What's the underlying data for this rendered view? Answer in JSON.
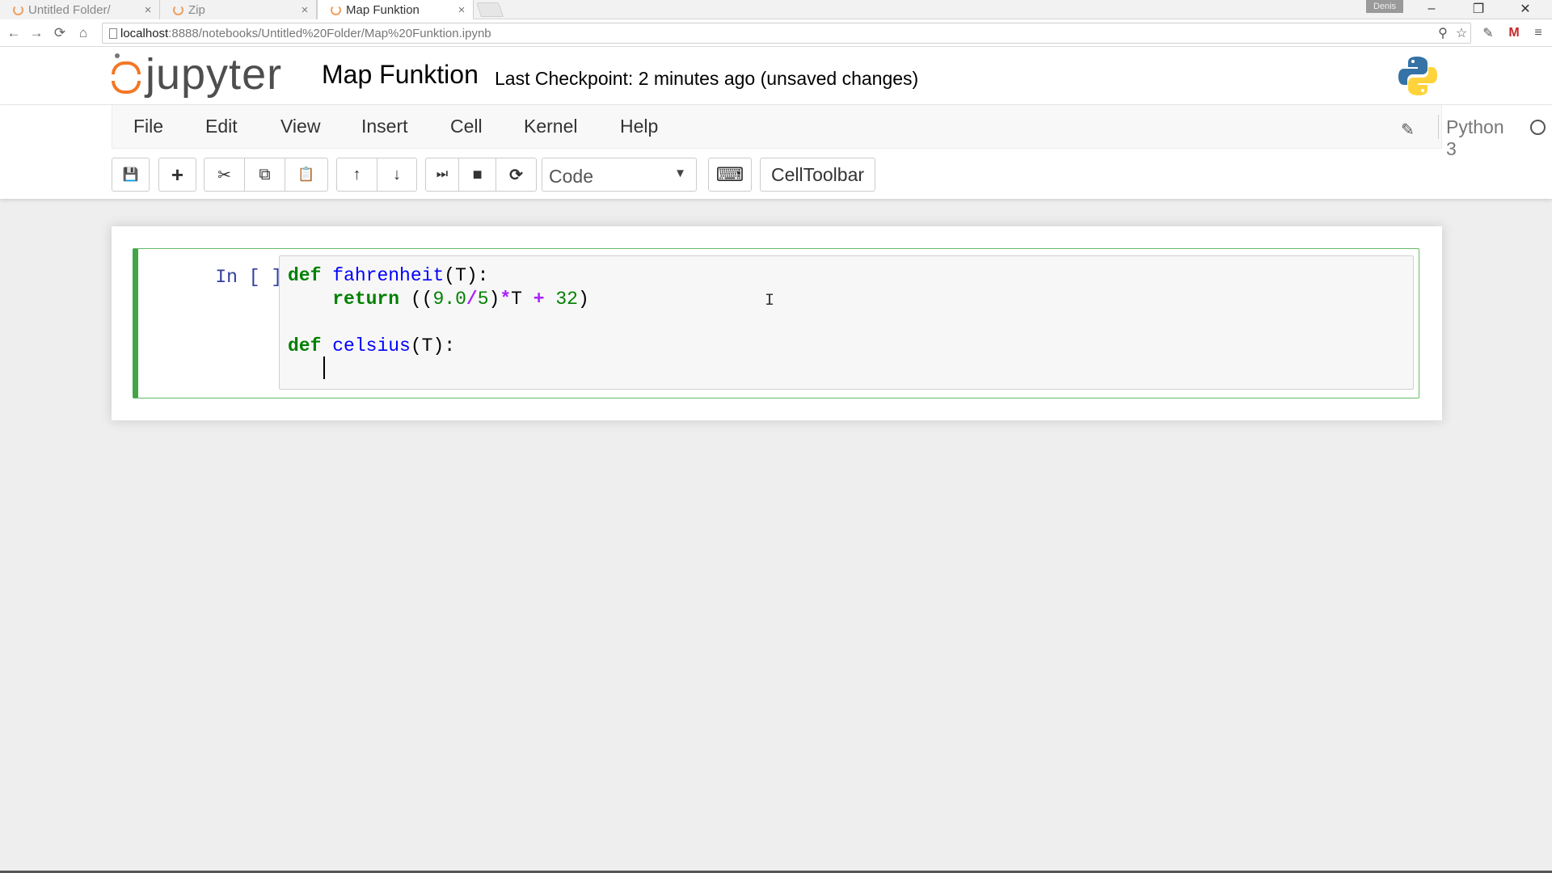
{
  "browser": {
    "tabs": [
      {
        "label": "Untitled Folder/",
        "close": "×"
      },
      {
        "label": "Zip",
        "close": "×"
      },
      {
        "label": "Map Funktion",
        "close": "×"
      }
    ],
    "profile": "Denis",
    "window_controls": {
      "minimize": "–",
      "restore": "❐",
      "close": "✕"
    },
    "nav": {
      "back": "←",
      "forward": "→",
      "reload": "⟳",
      "home": "⌂"
    },
    "url_host": "localhost",
    "url_rest": ":8888/notebooks/Untitled%20Folder/Map%20Funktion.ipynb",
    "extensions": {
      "zoom": "⚲",
      "star": "☆",
      "ext1": "✎",
      "gmail": "M",
      "menu": "≡"
    }
  },
  "jupyter": {
    "logo_text": "jupyter",
    "notebook_title": "Map Funktion",
    "checkpoint": "Last Checkpoint: 2 minutes ago (unsaved changes)",
    "brand_orange": "#f37726"
  },
  "menubar": {
    "items": [
      "File",
      "Edit",
      "View",
      "Insert",
      "Cell",
      "Kernel",
      "Help"
    ],
    "edit_icon": "✎",
    "kernel_name": "Python 3"
  },
  "toolbar": {
    "save": "💾",
    "add": "+",
    "cut": "✂",
    "copy": "⧉",
    "paste": "📋",
    "move_up": "↑",
    "move_down": "↓",
    "run": "⏭",
    "stop": "■",
    "restart": "⟳",
    "cell_type": "Code",
    "cell_type_caret": "▼",
    "keyboard": "⌨",
    "celltoolbar": "CellToolbar"
  },
  "cell": {
    "prompt": "In [ ]:",
    "code_lines": [
      {
        "kw": "def",
        "fn": "fahrenheit",
        "rest": "(T):"
      },
      {
        "kw": "return",
        "p1": " ((",
        "n1": "9.0",
        "op1": "/",
        "n2": "5",
        "p2": ")",
        "op2": "*",
        "p3": "T ",
        "op3": "+",
        "p4": " ",
        "n3": "32",
        "p5": ")"
      },
      {
        "kw": "def",
        "fn": "celsius",
        "rest": "(T):"
      }
    ],
    "ibeam": "I"
  }
}
